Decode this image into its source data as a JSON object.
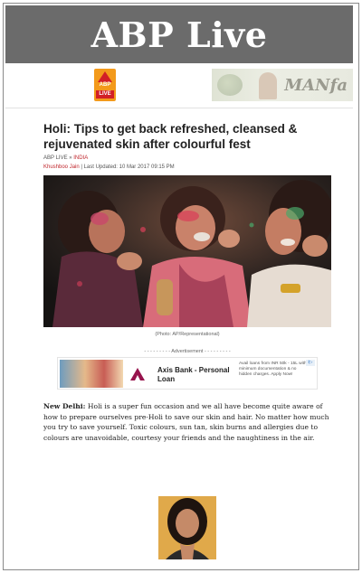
{
  "banner": {
    "title": "ABP Live"
  },
  "header": {
    "logo_top": "ABP",
    "logo_bottom": "LIVE",
    "ad_brand": "MANfa"
  },
  "article": {
    "title": "Holi: Tips to get back refreshed, cleansed & rejuvenated skin after colourful fest",
    "breadcrumb": {
      "home": "ABP LIVE",
      "sep": "»",
      "section": "INDIA"
    },
    "author": "Khushboo Jain",
    "updated_label": " | Last Updated: ",
    "updated": "10 Mar 2017 09:15 PM",
    "photo_caption": "(Photo: AP/Representational)",
    "body_place": "New Delhi:",
    "body": " Holi is a super fun occasion and we all have become quite aware of how to prepare ourselves pre-Holi to save our skin and hair. No matter how much you try to save yourself. Toxic colours, sun tan, skin burns and allergies due to colours are unavoidable, courtesy your friends and the naughtiness in the air."
  },
  "advertisement": {
    "label": "- - - - - - - - - Advertisement - - - - - - - - -",
    "title": "Axis Bank - Personal Loan",
    "description": "Avail loans from INR 50k - 15L with minimum documentation & no hidden charges. Apply Now!",
    "choices_label": "i▷"
  },
  "colors": {
    "banner_bg": "#6b6b6b",
    "accent_red": "#c0272d",
    "logo_orange": "#f39a1b"
  }
}
